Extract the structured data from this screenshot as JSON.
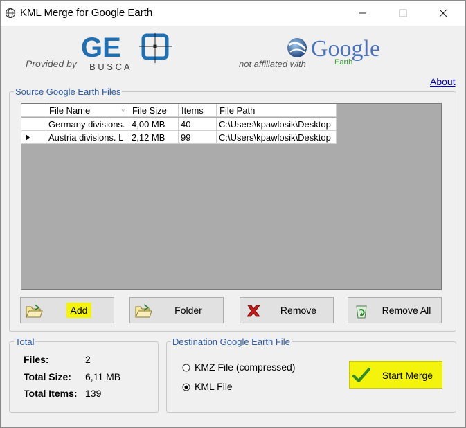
{
  "window": {
    "title": "KML Merge for Google Earth"
  },
  "branding": {
    "provided_by": "Provided by",
    "geo_letters": "GE",
    "busca_letters": "B U S C A",
    "not_affiliated": "not affiliated with",
    "google_text": "Google",
    "earth_text": "Earth"
  },
  "about_link": "About",
  "source": {
    "title": "Source Google Earth Files",
    "columns": [
      "File Name",
      "File Size",
      "Items",
      "File Path"
    ],
    "rows": [
      {
        "name": "Germany divisions.",
        "size": "4,00 MB",
        "items": "40",
        "path": "C:\\Users\\kpawlosik\\Desktop",
        "current": false
      },
      {
        "name": "Austria divisions. L",
        "size": "2,12 MB",
        "items": "99",
        "path": "C:\\Users\\kpawlosik\\Desktop",
        "current": true
      }
    ]
  },
  "buttons": {
    "add": "Add",
    "folder": "Folder",
    "remove": "Remove",
    "remove_all": "Remove All"
  },
  "total": {
    "title": "Total",
    "files_label": "Files:",
    "files_value": "2",
    "size_label": "Total Size:",
    "size_value": "6,11 MB",
    "items_label": "Total Items:",
    "items_value": "139"
  },
  "destination": {
    "title": "Destination Google Earth File",
    "option_kmz": "KMZ File (compressed)",
    "option_kml": "KML File",
    "selected": "kml"
  },
  "start_merge": "Start Merge",
  "colors": {
    "highlight": "#f3f30c",
    "group_title": "#2d5ca8",
    "geo_blue": "#1f6fb2",
    "grid_background": "#ababab"
  }
}
